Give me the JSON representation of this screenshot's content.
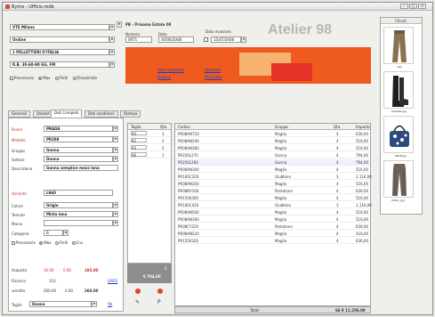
{
  "window": {
    "title": "Bymo - Ufficio.mdb",
    "min": "–",
    "max": "□",
    "close": "×"
  },
  "header": {
    "sede": "VTE Milano",
    "tipo": "Ordine",
    "fornitore": "1 PELLETTIERI D'ITALIA",
    "pagamento": "R.B. 30-60-90 GG. FM",
    "doc_title": "PB - Prisoma Estate 08",
    "numero_label": "Numero",
    "numero": "0671",
    "data_label": "Data",
    "data": "30/06/2008",
    "data_evasione_label": "Data evasione",
    "data_evasione": "15/07/2008",
    "radios": [
      "Provvisorio",
      "Max",
      "Finiti",
      "Tessutiristo"
    ],
    "radio_selected": 1,
    "links": [
      "Dato completo",
      "Stampati",
      "Duplica",
      "Storicizza"
    ],
    "logo_text": "Atelier 98"
  },
  "tabs": [
    "Generali",
    "Valutari",
    "Dati Completi",
    "Dati condizioni",
    "Stampa"
  ],
  "active_tab": 2,
  "form": {
    "fields": [
      {
        "label": "Brand",
        "value": "PRADA",
        "red": false
      },
      {
        "label": "Modello",
        "value": "PR208",
        "red": true
      },
      {
        "label": "Gruppo",
        "value": "Gonna",
        "red": false
      },
      {
        "label": "Settore",
        "value": "Donna",
        "red": false
      },
      {
        "label": "Descrizione",
        "value": "Gonna semplice mezz lana",
        "red": false
      }
    ],
    "fields2": [
      {
        "label": "Variante",
        "value": "L960",
        "red": true
      },
      {
        "label": "Colore",
        "value": "Grigio",
        "red": false
      },
      {
        "label": "Tessuto",
        "value": "Mista lana",
        "red": false
      },
      {
        "label": "Marca",
        "value": "",
        "red": false
      },
      {
        "label": "Categoria",
        "value": "B",
        "red": false
      }
    ],
    "radios2": [
      "Provvisorio",
      "Max",
      "Finiti",
      "Cnv"
    ],
    "radio2_selected": 1
  },
  "prices": {
    "acquisto_label": "Acquisto",
    "acquisto": [
      "10.00",
      "0.00",
      "185.00"
    ],
    "ricarico_label": "Ricarico",
    "ricarico": "110",
    "ricarico_unit": "LIRES",
    "vendita_label": "vendita",
    "vendita": [
      "260.00",
      "0.00",
      "260.00"
    ],
    "taglie_label": "Taglie",
    "taglie_value": "Donna",
    "taglie_link": "tbl"
  },
  "sizes": {
    "headers": [
      "Taglia",
      "Qta"
    ],
    "rows": [
      [
        "40",
        "1"
      ],
      [
        "42",
        "2"
      ],
      [
        "44",
        "2"
      ],
      [
        "46",
        "1"
      ]
    ],
    "total_qta": "6",
    "total_amount": "€ 794,00"
  },
  "grid": {
    "headers": [
      "Codice",
      "Gruppo",
      "Qta",
      "Importo"
    ],
    "rows": [
      [
        "PR08AN720",
        "Maglia",
        "4",
        "636,00"
      ],
      [
        "PR08AN240",
        "Maglia",
        "4",
        "516,00"
      ],
      [
        "PR08AN360",
        "Maglia",
        "4",
        "516,00"
      ],
      [
        "PR250L270",
        "Gonna",
        "4",
        "794,00"
      ],
      [
        "PR250L260",
        "Gonna",
        "4",
        "794,00"
      ],
      [
        "PR08AN300",
        "Maglia",
        "4",
        "516,00"
      ],
      [
        "PR100C320",
        "Giubbino",
        "3",
        "1.116,00"
      ],
      [
        "PR08AN300",
        "Maglia",
        "4",
        "516,00"
      ],
      [
        "PR08NY100",
        "Pantalone",
        "4",
        "636,00"
      ],
      [
        "PR155K300",
        "Maglia",
        "4",
        "516,00"
      ],
      [
        "PR100C420",
        "Giubbino",
        "3",
        "1.116,00"
      ],
      [
        "PR08AN500",
        "Maglia",
        "4",
        "516,00"
      ],
      [
        "PR08AN160",
        "Maglia",
        "4",
        "516,00"
      ],
      [
        "PR08CY220",
        "Pantalone",
        "4",
        "636,00"
      ],
      [
        "PR08AN220",
        "Maglia",
        "4",
        "516,00"
      ],
      [
        "PR155K320",
        "Maglia",
        "4",
        "636,00"
      ]
    ],
    "total_label": "Totali",
    "total_value": "66 € 11.256,00"
  },
  "thumbs": {
    "header": "Chiudi",
    "items": [
      {
        "label": "...jpg",
        "icon": "trousers-image"
      },
      {
        "label": "000000.jpg",
        "icon": "boots-image"
      },
      {
        "label": "PR2P.jpg",
        "icon": "bag-image"
      },
      {
        "label": "0000_.jpg",
        "icon": "pants-image"
      }
    ]
  },
  "colors": {
    "accent_orange": "#ef5a1f",
    "logo_grey": "#b7b7b7",
    "link_blue": "#1a3fc4",
    "red_label": "#c62828"
  }
}
